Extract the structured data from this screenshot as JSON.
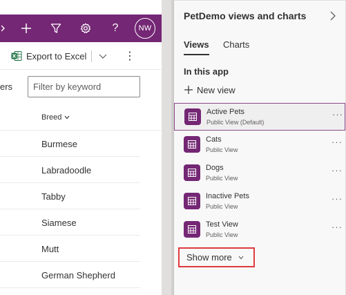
{
  "topbar": {
    "color": "#742774",
    "icons": [
      "plus-icon",
      "filter-icon",
      "gear-icon",
      "help-icon"
    ],
    "help_glyph": "?",
    "avatar_initials": "NW"
  },
  "command_bar": {
    "export_label": "Export to Excel",
    "more_glyph": "⋮"
  },
  "filters": {
    "label_fragment": "ers",
    "keyword_placeholder": "Filter by keyword"
  },
  "grid": {
    "column_header": "Breed",
    "rows": [
      "Burmese",
      "Labradoodle",
      "Tabby",
      "Siamese",
      "Mutt",
      "German Shepherd"
    ]
  },
  "panel": {
    "title": "PetDemo views and charts",
    "tabs": [
      {
        "label": "Views",
        "selected": true
      },
      {
        "label": "Charts",
        "selected": false
      }
    ],
    "section_label": "In this app",
    "new_view_label": "New view",
    "views": [
      {
        "name": "Active Pets",
        "subtitle": "Public View (Default)",
        "active": true
      },
      {
        "name": "Cats",
        "subtitle": "Public View",
        "active": false
      },
      {
        "name": "Dogs",
        "subtitle": "Public View",
        "active": false
      },
      {
        "name": "Inactive Pets",
        "subtitle": "Public View",
        "active": false
      },
      {
        "name": "Test View",
        "subtitle": "Public View",
        "active": false
      }
    ],
    "item_more_glyph": "···",
    "show_more_label": "Show more",
    "highlight_color": "#e0393e"
  }
}
